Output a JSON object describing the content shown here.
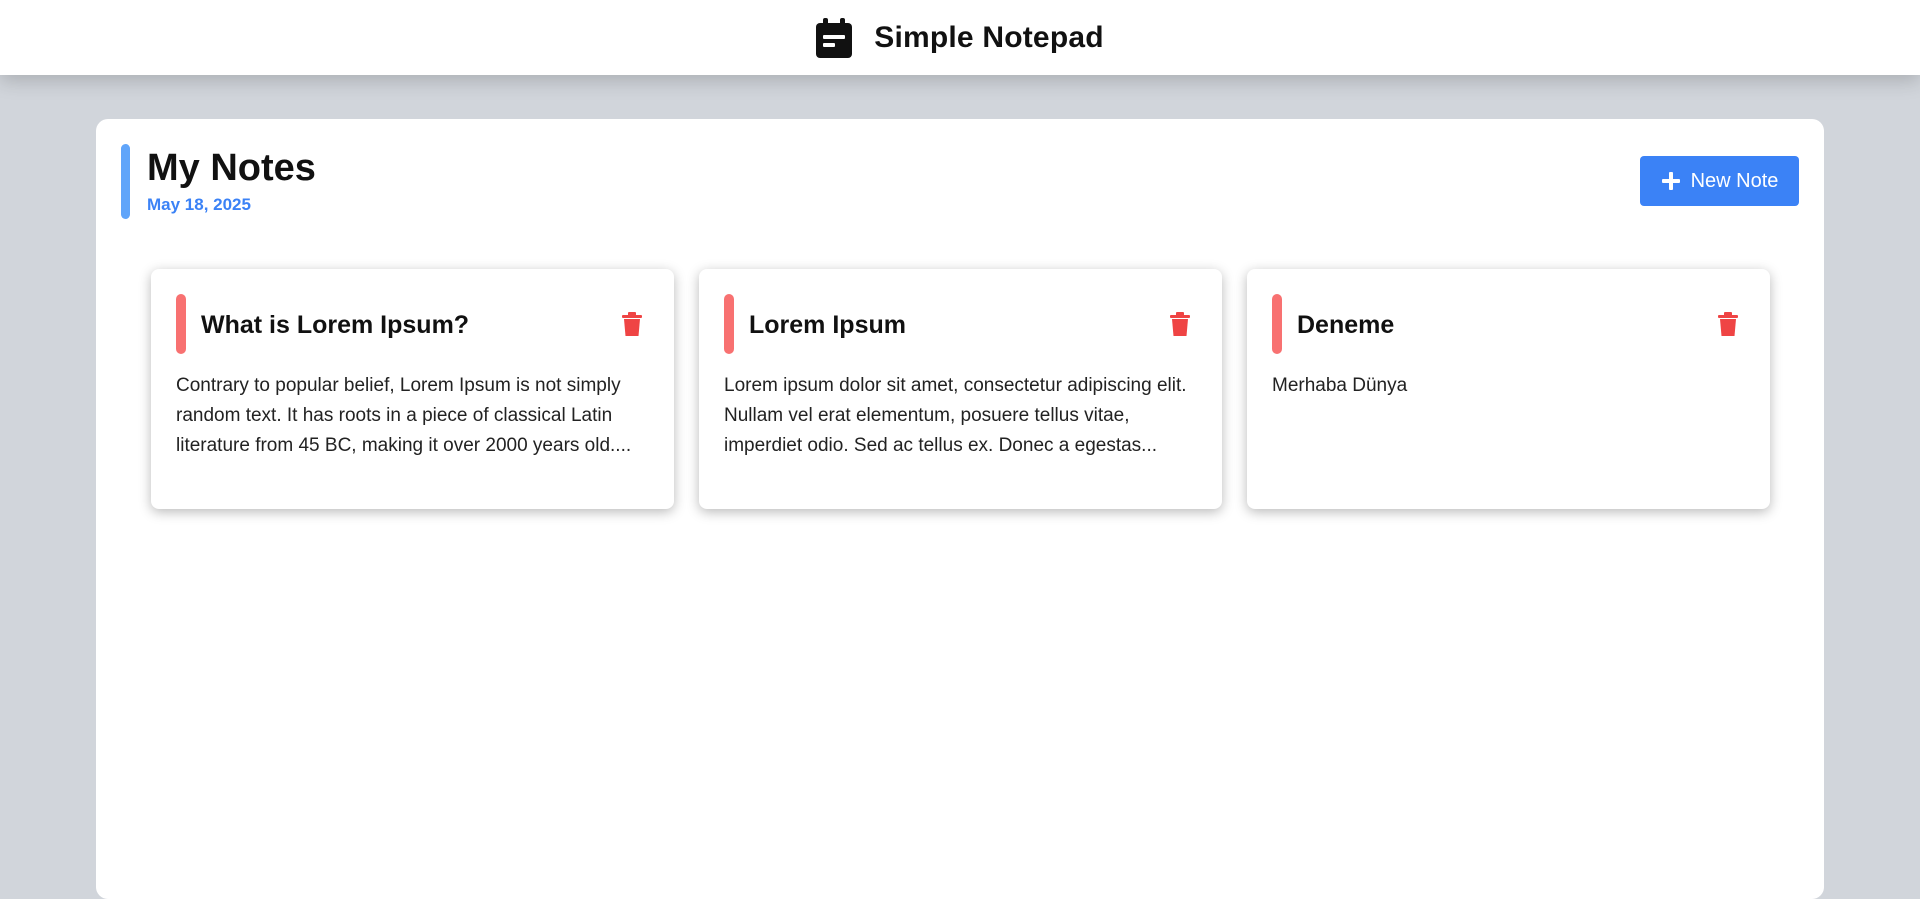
{
  "app": {
    "title": "Simple Notepad",
    "icon": "notepad-icon"
  },
  "page": {
    "title": "My Notes",
    "date": "May 18, 2025"
  },
  "actions": {
    "new_note_label": "New Note",
    "new_note_icon": "plus-icon"
  },
  "colors": {
    "primary": "#3b82f6",
    "header_accent": "#60a5fa",
    "note_accent": "#f87171",
    "delete": "#ef4444",
    "background": "#d1d5db"
  },
  "notes": [
    {
      "title": "What is Lorem Ipsum?",
      "preview": "Contrary to popular belief, Lorem Ipsum is not simply random text. It has roots in a piece of classical Latin literature from 45 BC, making it over 2000 years old....",
      "delete_icon": "trash-icon"
    },
    {
      "title": "Lorem Ipsum",
      "preview": "Lorem ipsum dolor sit amet, consectetur adipiscing elit. Nullam vel erat elementum, posuere tellus vitae, imperdiet odio. Sed ac tellus ex. Donec a egestas...",
      "delete_icon": "trash-icon"
    },
    {
      "title": "Deneme",
      "preview": "Merhaba Dünya",
      "delete_icon": "trash-icon"
    }
  ]
}
